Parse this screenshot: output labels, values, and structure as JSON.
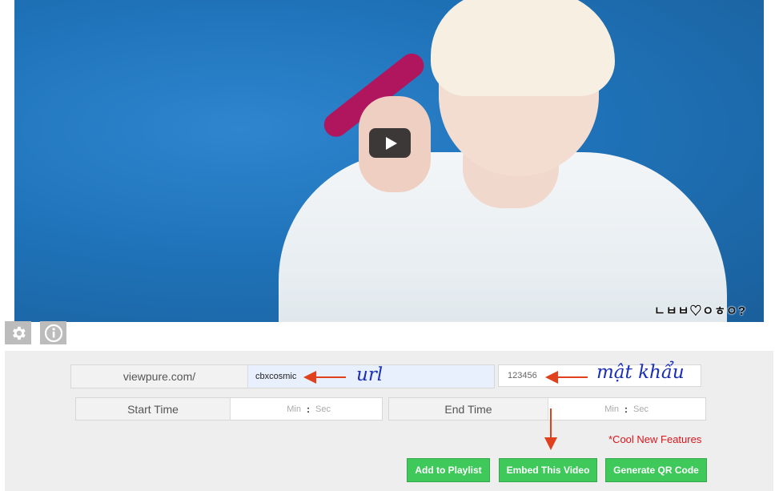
{
  "video": {
    "watermark": "ㄴㅂㅂ♡ㅇㅎㅇ?"
  },
  "toolbar": {
    "settings_icon": "gear-icon",
    "info_icon": "info-icon"
  },
  "url_row": {
    "prefix": "viewpure.com/",
    "url_value": "cbxcosmic",
    "password_value": "123456",
    "url_annotation": "url",
    "password_annotation": "mật khẩu"
  },
  "time_row": {
    "start_label": "Start Time",
    "end_label": "End Time",
    "min_placeholder": "Min",
    "sec_placeholder": "Sec",
    "separator": ":"
  },
  "features_note": "*Cool New Features",
  "buttons": {
    "add_playlist": "Add to Playlist",
    "embed": "Embed This Video",
    "qr": "Generate QR Code"
  },
  "colors": {
    "accent_green": "#3ec95a",
    "annotation_blue": "#1a2fb8",
    "arrow_red": "#e0401b",
    "note_red": "#d8151b"
  }
}
